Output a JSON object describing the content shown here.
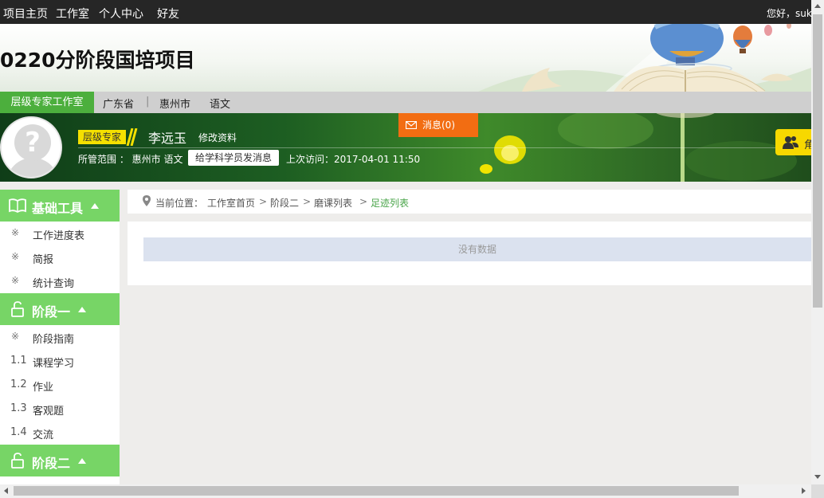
{
  "topnav": {
    "items": [
      "项目主页",
      "工作室",
      "个人中心",
      "好友"
    ],
    "greeting": "您好，suk"
  },
  "banner": {
    "title": "0220分阶段国培项目"
  },
  "location": {
    "studio": "层级专家工作室",
    "province": "广东省",
    "separator": "|",
    "city": "惠州市",
    "subject": "语文"
  },
  "profile": {
    "role": "层级专家",
    "name": "李远玉",
    "edit_label": "修改资料",
    "scope": "所管范围 ： 惠州市 语文",
    "message_button": "给学科学员发消息",
    "last_visit": "上次访问：2017-04-01 11:50",
    "messages_label": "消息(0)",
    "yellow_tab_label": "角"
  },
  "sidebar": {
    "sections": [
      {
        "title": "基础工具",
        "icon": "book-icon",
        "items": [
          {
            "mark": "※",
            "label": "工作进度表"
          },
          {
            "mark": "※",
            "label": "简报"
          },
          {
            "mark": "※",
            "label": "统计查询"
          }
        ]
      },
      {
        "title": "阶段一",
        "icon": "unlock-icon",
        "items": [
          {
            "mark": "※",
            "label": "阶段指南"
          },
          {
            "num": "1.1",
            "label": "课程学习"
          },
          {
            "num": "1.2",
            "label": "作业"
          },
          {
            "num": "1.3",
            "label": "客观题"
          },
          {
            "num": "1.4",
            "label": "交流"
          }
        ]
      },
      {
        "title": "阶段二",
        "icon": "unlock-icon",
        "items": []
      }
    ]
  },
  "breadcrumb": {
    "prefix": "当前位置：",
    "items": [
      "工作室首页",
      "阶段二",
      "磨课列表",
      "足迹列表"
    ],
    "separator": ">"
  },
  "content": {
    "empty_text": "没有数据"
  },
  "colors": {
    "green": "#77d566",
    "studio_green": "#4caf3d",
    "orange": "#f26d12",
    "yellow": "#f7d800",
    "topbar": "#262626"
  }
}
